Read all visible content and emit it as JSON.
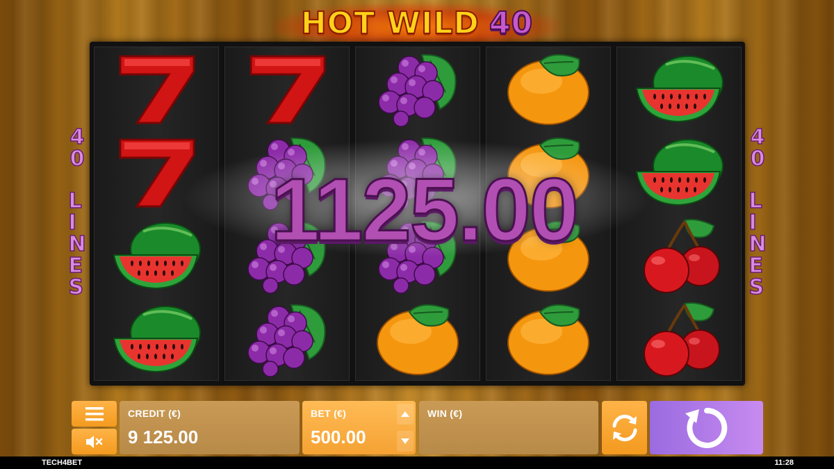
{
  "game": {
    "title_main": "HOT WILD",
    "title_number": "40",
    "side_label_number": "40",
    "side_label_word": "LINES"
  },
  "reels": [
    [
      "seven",
      "seven",
      "watermelon",
      "watermelon"
    ],
    [
      "seven",
      "grapes",
      "grapes",
      "grapes"
    ],
    [
      "grapes",
      "grapes",
      "grapes",
      "orange"
    ],
    [
      "orange",
      "orange",
      "orange",
      "orange"
    ],
    [
      "watermelon",
      "watermelon",
      "cherries",
      "cherries"
    ]
  ],
  "win_display": {
    "amount": "1125.00"
  },
  "controls": {
    "menu_icon": "hamburger-icon",
    "sound_icon": "speaker-muted-icon",
    "credit": {
      "label": "CREDIT (€)",
      "value": "9 125.00"
    },
    "bet": {
      "label": "BET (€)",
      "value": "500.00"
    },
    "win": {
      "label": "WIN (€)",
      "value": ""
    },
    "autoplay_icon": "autoplay-refresh-icon",
    "spin_icon": "spin-arrow-icon"
  },
  "footer": {
    "brand": "TECH4BET",
    "time": "11:28"
  },
  "colors": {
    "orange_button": "#f39a1f",
    "panel_brown": "#c99a55",
    "spin_purple": "#b07ae8",
    "win_text": "#b24fb3"
  }
}
